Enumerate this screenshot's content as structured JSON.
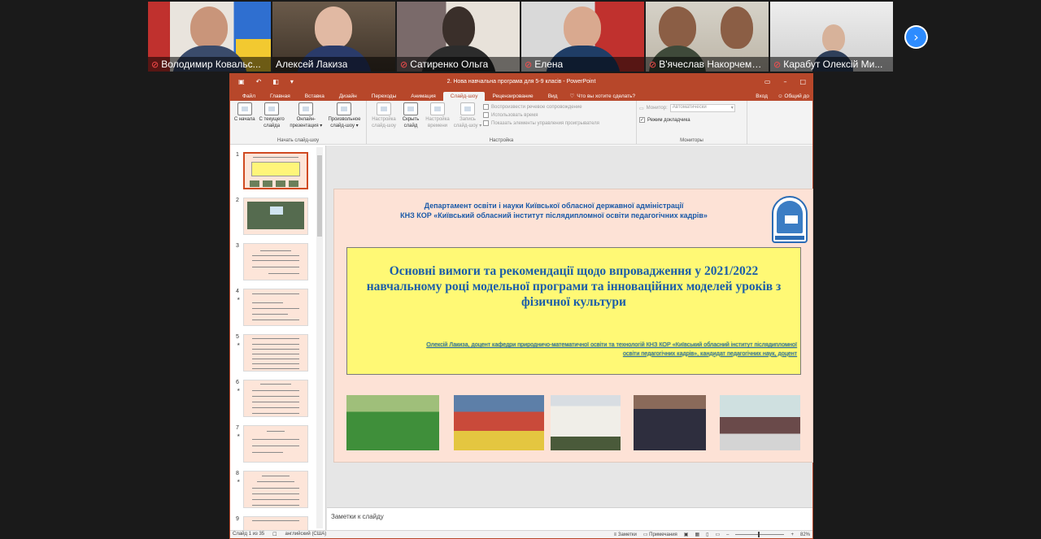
{
  "meeting": {
    "participants": [
      {
        "name": "Володимир Ковальс...",
        "muted": true
      },
      {
        "name": "Алексей Лакиза",
        "muted": false,
        "active": true
      },
      {
        "name": "Сатиренко Ольга",
        "muted": true
      },
      {
        "name": "Елена",
        "muted": true
      },
      {
        "name": "В'ячеслав Накорчемний",
        "muted": true
      },
      {
        "name": "Карабут Олексій Ми...",
        "muted": true
      }
    ],
    "next_icon": "chevron-right-icon"
  },
  "powerpoint": {
    "doc_title": "2. Нова навчальна програма для 5-9 класів - PowerPoint",
    "tabs": [
      "Файл",
      "Главная",
      "Вставка",
      "Дизайн",
      "Переходы",
      "Анимация",
      "Слайд-шоу",
      "Рецензирование",
      "Вид"
    ],
    "selected_tab": "Слайд-шоу",
    "tell_me": "Что вы хотите сделать?",
    "signin": "Вход",
    "share": "Общий до",
    "ribbon": {
      "start_group": {
        "label": "Начать слайд-шоу",
        "buttons": [
          "С начала",
          "С текущего слайда",
          "Онлайн-презентация ▾",
          "Произвольное слайд-шоу ▾"
        ]
      },
      "setup_group": {
        "label": "Настройка",
        "buttons": [
          "Настройка слайд-шоу",
          "Скрыть слайд",
          "Настройка времени",
          "Запись слайд-шоу ▾"
        ],
        "checks": [
          "Воспроизвести речевое сопровождение",
          "Использовать время",
          "Показать элементы управления проигрывателя"
        ]
      },
      "monitors_group": {
        "label": "Мониторы",
        "monitor_label": "Монитор:",
        "monitor_value": "Автоматически",
        "presenter_view": "Режим докладчика"
      }
    },
    "thumbnails": [
      "1",
      "2",
      "3",
      "4",
      "5",
      "6",
      "7",
      "8",
      "9"
    ],
    "slide": {
      "header_line1": "Департамент освіти і науки Київської обласної державної адміністрації",
      "header_line2": "КНЗ КОР «Київський обласний інститут післядипломної освіти педагогічних кадрів»",
      "title": "Основні вимоги та рекомендації щодо впровадження у 2021/2022 навчальному році модельної програми та інноваційних моделей уроків з фізичної культури",
      "author": "Олексій Лакиза, доцент кафедри природничо-математичної освіти та технологій КНЗ КОР «Київський обласний інститут післядипломної освіти педагогічних кадрів», кандидат педагогічних наук, доцент"
    },
    "notes_placeholder": "Заметки к слайду",
    "status": {
      "slide_counter": "Слайд 1 из 35",
      "language": "английский (США)",
      "notes_btn": "Заметки",
      "comments_btn": "Примечания",
      "zoom": "82%"
    }
  }
}
